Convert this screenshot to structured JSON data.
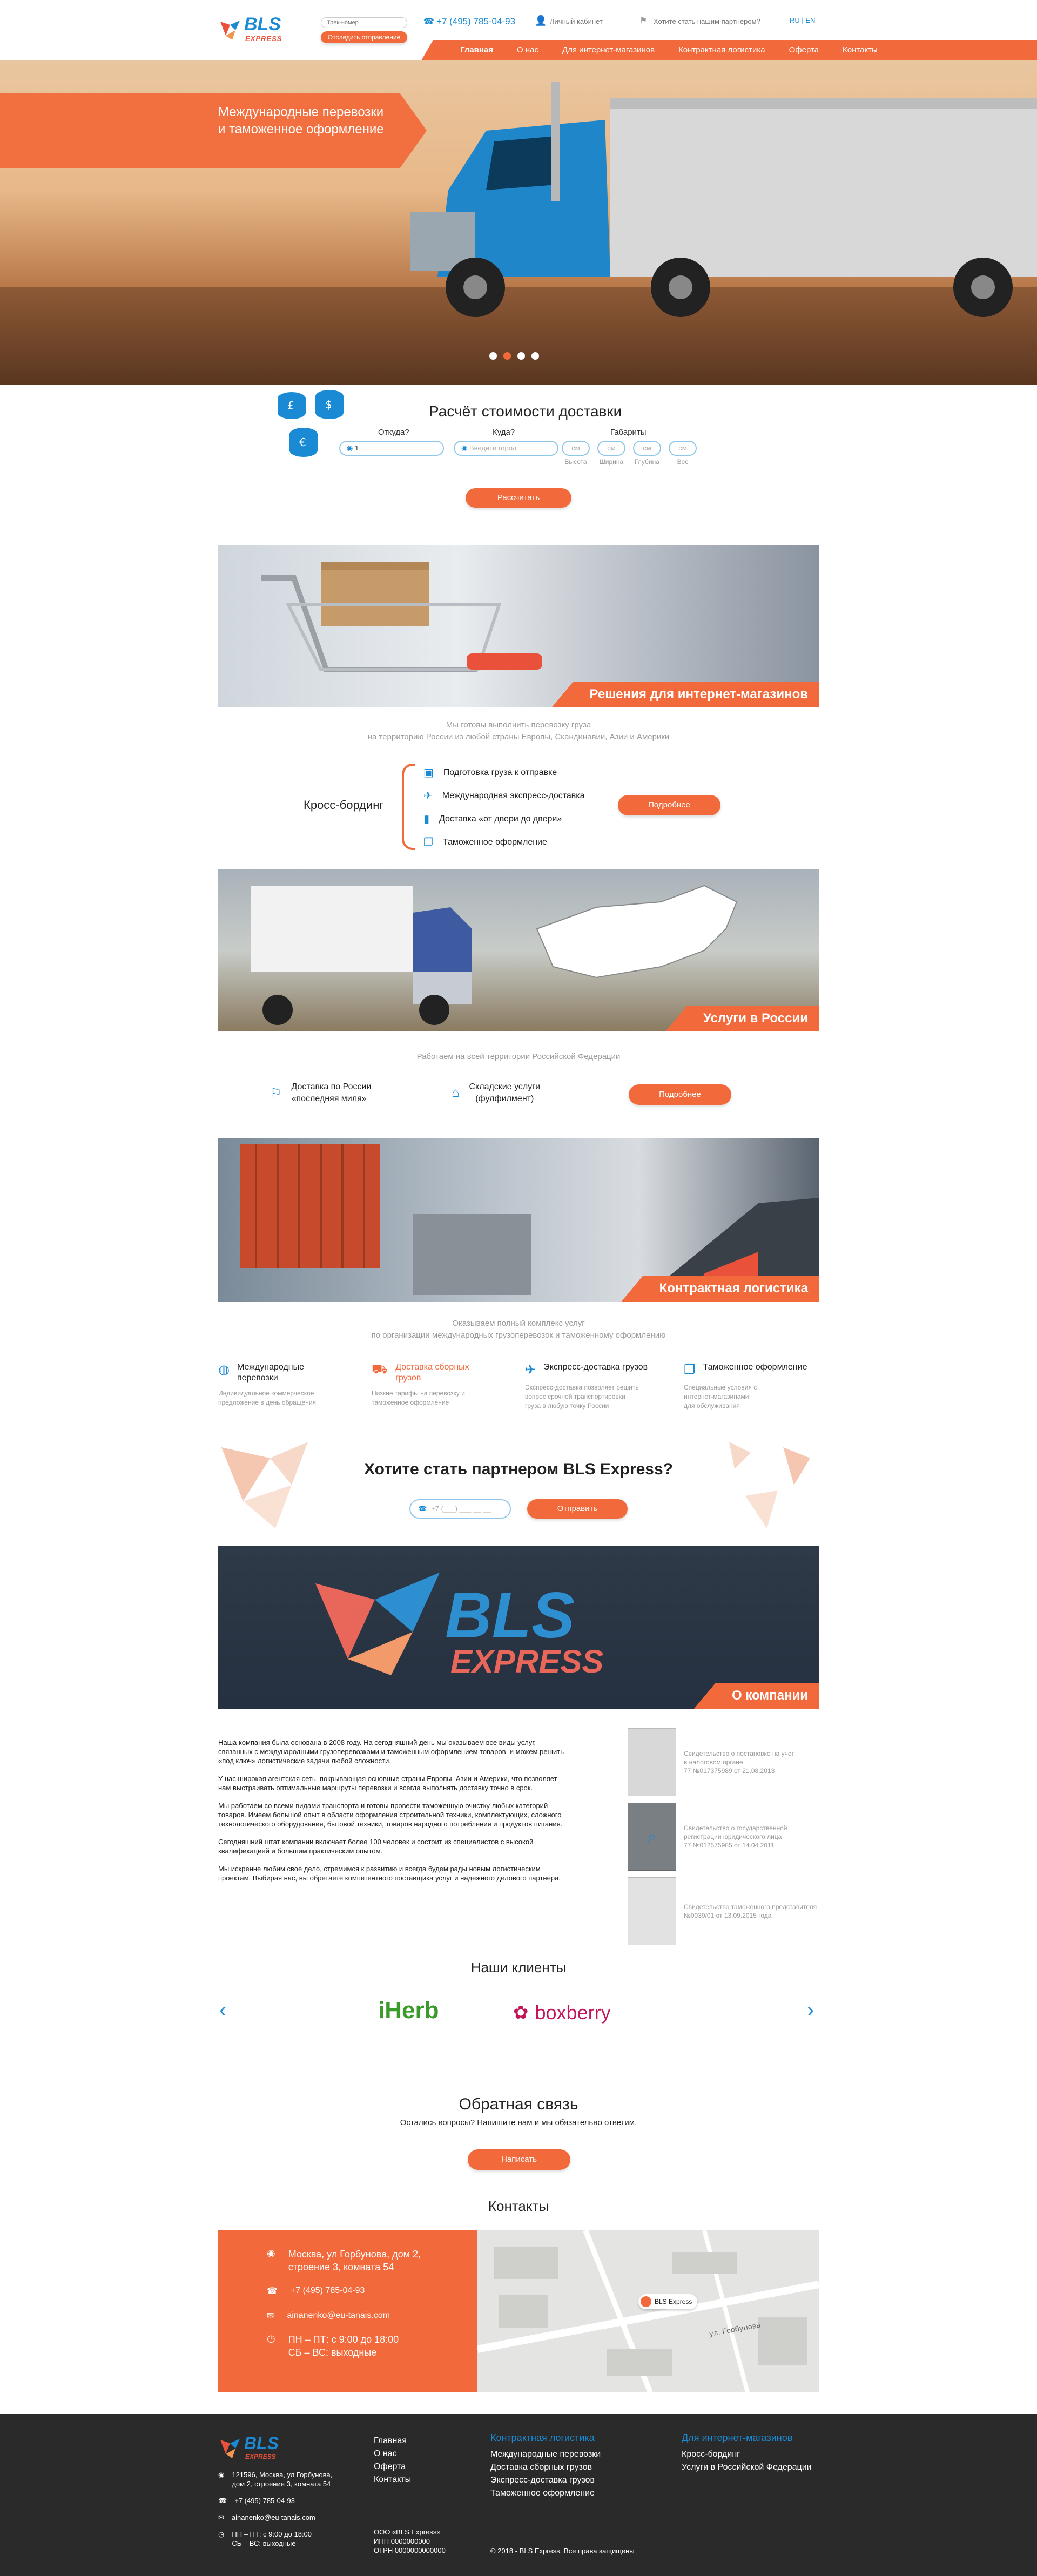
{
  "header": {
    "logo_main": "BLS",
    "logo_sub": "EXPRESS",
    "tracking_placeholder": "Трек-номер",
    "tracking_button": "Отследить отправление",
    "phone": "+7 (495) 785-04-93",
    "cabinet": "Личный кабинет",
    "partner_link": "Хотите стать нашим партнером?",
    "languages": "RU | EN",
    "nav": [
      "Главная",
      "О нас",
      "Для интернет-магазинов",
      "Контрактная логистика",
      "Оферта",
      "Контакты"
    ]
  },
  "hero": {
    "headline_line1": "Международные перевозки",
    "headline_line2": "и таможенное оформление"
  },
  "calculator": {
    "title": "Расчёт стоимости доставки",
    "from_label": "Откуда?",
    "to_label": "Куда?",
    "dims_label": "Габариты",
    "from_value": "1",
    "to_placeholder": "Введите город",
    "dim_fields": [
      "Высота",
      "Ширина",
      "Глубина",
      "Вес"
    ],
    "dim_unit": "см",
    "button": "Рассчитать"
  },
  "ecommerce": {
    "tag": "Решения для интернет-магазинов",
    "intro_line1": "Мы готовы выполнить перевозку груза",
    "intro_line2": "на территорию России из любой страны Европы, Скандинавии, Азии и Америки",
    "side_label": "Кросс-бординг",
    "items": [
      "Подготовка груза к отправке",
      "Международная экспресс-доставка",
      "Доставка «от двери до двери»",
      "Таможенное оформление"
    ],
    "button": "Подробнее"
  },
  "russia": {
    "tag": "Услуги в России",
    "intro": "Работаем на всей территории Российской Федерации",
    "service1_line1": "Доставка по России",
    "service1_line2": "«последняя миля»",
    "service2_line1": "Складские услуги",
    "service2_line2": "(фулфилмент)",
    "button": "Подробнее"
  },
  "contract": {
    "tag": "Контрактная логистика",
    "intro_line1": "Оказываем полный комплекс услуг",
    "intro_line2": "по организации международных грузоперевозок и таможенному оформлению",
    "cards": [
      {
        "title_line1": "Международные",
        "title_line2": "перевозки",
        "desc_line1": "Индивидуальное коммерческое",
        "desc_line2": "предложение в день обращения",
        "desc_line3": ""
      },
      {
        "title_line1": "Доставка сборных",
        "title_line2": "грузов",
        "desc_line1": "Низкие тарифы на перевозку и",
        "desc_line2": "таможенное оформление",
        "desc_line3": ""
      },
      {
        "title_line1": "Экспресс-доставка грузов",
        "title_line2": "",
        "desc_line1": "Экспресс-доставка позволяет решить",
        "desc_line2": "вопрос срочной транспортировки",
        "desc_line3": "груза в любую точку России"
      },
      {
        "title_line1": "Таможенное оформление",
        "title_line2": "",
        "desc_line1": "Специальные условия с",
        "desc_line2": "интернет-магазинами",
        "desc_line3": "для обслуживания"
      }
    ]
  },
  "partner": {
    "title": "Хотите стать партнером BLS Express?",
    "phone_placeholder": "+7 (___) ___-__-__",
    "button": "Отправить"
  },
  "about": {
    "tag": "О компании",
    "logo_main": "BLS",
    "logo_sub": "EXPRESS",
    "paragraphs": [
      "Наша компания была основана в 2008 году. На сегодняшний день мы оказываем все виды услуг, связанных с международными грузоперевозками и таможенным оформлением товаров, и можем решить «под ключ» логистические задачи любой сложности.",
      "У нас широкая агентская сеть, покрывающая основные страны Европы, Азии и Америки, что позволяет нам выстраивать оптимальные маршруты перевозки и всегда выполнять доставку точно в срок.",
      "Мы работаем со всеми видами транспорта и готовы провести таможенную очистку любых категорий товаров. Имеем большой опыт в области оформления строительной техники, комплектующих, сложного технологического оборудования, бытовой техники, товаров народного потребления и продуктов питания.",
      "Сегодняшний штат компании включает более 100 человек и состоит из специалистов с высокой квалификацией и большим практическим опытом.",
      "Мы искренне любим свое дело, стремимся к развитию и всегда будем рады новым логистическим проектам. Выбирая нас, вы обретаете компетентного поставщика услуг и надежного делового партнера."
    ],
    "certificates": [
      {
        "line1": "Свидетельство о постановке на учет",
        "line2": "в налоговом органе",
        "line3": "77 №017375989 от 21.08.2013"
      },
      {
        "line1": "Свидетельство о государственной",
        "line2": "регистрации юридического лица",
        "line3": "77 №012575985 от 14.04.2011"
      },
      {
        "line1": "Свидетельство таможенного представителя",
        "line2": "№0039/01 от 13.09.2015 года",
        "line3": ""
      }
    ]
  },
  "clients": {
    "title": "Наши клиенты",
    "logos": [
      "iHerb",
      "boxberry"
    ]
  },
  "feedback": {
    "title": "Обратная связь",
    "subtitle": "Остались вопросы? Напишите нам и мы обязательно ответим.",
    "button": "Написать"
  },
  "contacts": {
    "title": "Контакты",
    "address_line1": "Москва, ул Горбунова, дом 2,",
    "address_line2": "строение 3, комната 54",
    "phone": "+7 (495) 785-04-93",
    "email": "ainanenko@eu-tanais.com",
    "hours_line1": "ПН – ПТ: с 9:00 до 18:00",
    "hours_line2": "СБ – ВС: выходные",
    "map_label": "BLS Express",
    "map_street": "ул. Горбунова"
  },
  "footer": {
    "logo_main": "BLS",
    "logo_sub": "EXPRESS",
    "address_line1": "121596, Москва, ул Горбунова,",
    "address_line2": "дом 2, строение 3, комната 54",
    "phone": "+7 (495) 785-04-93",
    "email": "ainanenko@eu-tanais.com",
    "hours_line1": "ПН – ПТ: с 9:00 до 18:00",
    "hours_line2": "СБ – ВС: выходные",
    "col1": [
      "Главная",
      "О нас",
      "Оферта",
      "Контакты"
    ],
    "col2_title": "Контрактная логистика",
    "col2": [
      "Международные перевозки",
      "Доставка сборных грузов",
      "Экспресс-доставка грузов",
      "Таможенное оформление"
    ],
    "col3_title": "Для интернет-магазинов",
    "col3": [
      "Кросс-бординг",
      "Услуги в Российской Федерации"
    ],
    "legal_line1": "ООО «BLS Express»",
    "legal_line2": "ИНН 0000000000",
    "legal_line3": "ОГРН 0000000000000",
    "copyright": "© 2018 - BLS Express. Все права защищены"
  },
  "colors": {
    "accent": "#f26a3b",
    "blue": "#1a8ad4",
    "dark": "#2a2a2a"
  }
}
